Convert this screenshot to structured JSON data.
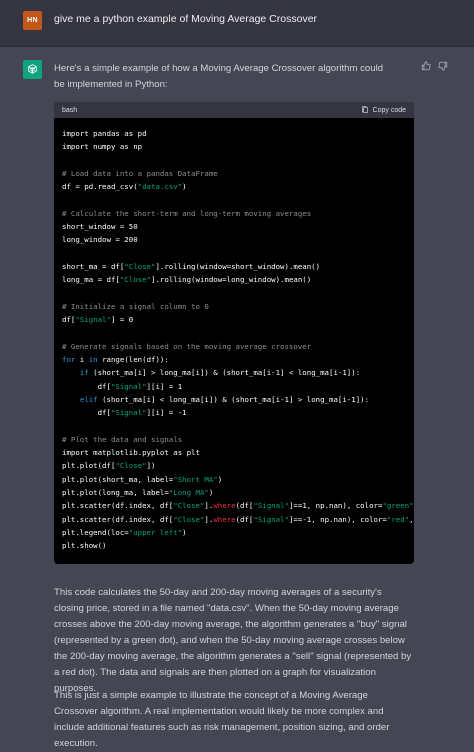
{
  "user": {
    "initials": "HN",
    "message": "give me a python example of Moving Average Crossover"
  },
  "assistant": {
    "intro": "Here's a simple example of how a Moving Average Crossover algorithm could be implemented in Python:",
    "code_language": "bash",
    "copy_label": "Copy code",
    "code_lines": [
      [
        {
          "t": "import pandas as pd",
          "c": ""
        }
      ],
      [
        {
          "t": "import numpy as np",
          "c": ""
        }
      ],
      [],
      [
        {
          "t": "# Load data into a pandas DataFrame",
          "c": "cm"
        }
      ],
      [
        {
          "t": "df = pd.read_csv(",
          "c": ""
        },
        {
          "t": "\"data.csv\"",
          "c": "st"
        },
        {
          "t": ")",
          "c": ""
        }
      ],
      [],
      [
        {
          "t": "# Calculate the short-term and long-term moving averages",
          "c": "cm"
        }
      ],
      [
        {
          "t": "short_window = 50",
          "c": ""
        }
      ],
      [
        {
          "t": "long_window = 200",
          "c": ""
        }
      ],
      [],
      [
        {
          "t": "short_ma = df[",
          "c": ""
        },
        {
          "t": "\"Close\"",
          "c": "st"
        },
        {
          "t": "].rolling(window=short_window).mean()",
          "c": ""
        }
      ],
      [
        {
          "t": "long_ma = df[",
          "c": ""
        },
        {
          "t": "\"Close\"",
          "c": "st"
        },
        {
          "t": "].rolling(window=long_window).mean()",
          "c": ""
        }
      ],
      [],
      [
        {
          "t": "# Initialize a signal column to 0",
          "c": "cm"
        }
      ],
      [
        {
          "t": "df[",
          "c": ""
        },
        {
          "t": "\"Signal\"",
          "c": "st"
        },
        {
          "t": "] = 0",
          "c": ""
        }
      ],
      [],
      [
        {
          "t": "# Generate signals based on the moving average crossover",
          "c": "cm"
        }
      ],
      [
        {
          "t": "for",
          "c": "kw"
        },
        {
          "t": " i ",
          "c": ""
        },
        {
          "t": "in",
          "c": "kw"
        },
        {
          "t": " range(len(df)):",
          "c": ""
        }
      ],
      [
        {
          "t": "    ",
          "c": ""
        },
        {
          "t": "if",
          "c": "kw"
        },
        {
          "t": " (short_ma[i] > long_ma[i]) & (short_ma[i-1] < long_ma[i-1]):",
          "c": ""
        }
      ],
      [
        {
          "t": "        df[",
          "c": ""
        },
        {
          "t": "\"Signal\"",
          "c": "st"
        },
        {
          "t": "][i] = 1",
          "c": ""
        }
      ],
      [
        {
          "t": "    ",
          "c": ""
        },
        {
          "t": "elif",
          "c": "kw"
        },
        {
          "t": " (short_ma[i] < long_ma[i]) & (short_ma[i-1] > long_ma[i-1]):",
          "c": ""
        }
      ],
      [
        {
          "t": "        df[",
          "c": ""
        },
        {
          "t": "\"Signal\"",
          "c": "st"
        },
        {
          "t": "][i] = -1",
          "c": ""
        }
      ],
      [],
      [
        {
          "t": "# Plot the data and signals",
          "c": "cm"
        }
      ],
      [
        {
          "t": "import matplotlib.pyplot as plt",
          "c": ""
        }
      ],
      [
        {
          "t": "plt.plot(df[",
          "c": ""
        },
        {
          "t": "\"Close\"",
          "c": "st"
        },
        {
          "t": "])",
          "c": ""
        }
      ],
      [
        {
          "t": "plt.plot(short_ma, label=",
          "c": ""
        },
        {
          "t": "\"Short MA\"",
          "c": "st"
        },
        {
          "t": ")",
          "c": ""
        }
      ],
      [
        {
          "t": "plt.plot(long_ma, label=",
          "c": ""
        },
        {
          "t": "\"Long MA\"",
          "c": "st"
        },
        {
          "t": ")",
          "c": ""
        }
      ],
      [
        {
          "t": "plt.scatter(df.index, df[",
          "c": ""
        },
        {
          "t": "\"Close\"",
          "c": "st"
        },
        {
          "t": "].",
          "c": ""
        },
        {
          "t": "where",
          "c": "fn"
        },
        {
          "t": "(df[",
          "c": ""
        },
        {
          "t": "\"Signal\"",
          "c": "st"
        },
        {
          "t": "]==1, np.nan), color=",
          "c": ""
        },
        {
          "t": "\"green\"",
          "c": "st"
        },
        {
          "t": ", lab",
          "c": ""
        }
      ],
      [
        {
          "t": "plt.scatter(df.index, df[",
          "c": ""
        },
        {
          "t": "\"Close\"",
          "c": "st"
        },
        {
          "t": "].",
          "c": ""
        },
        {
          "t": "where",
          "c": "fn"
        },
        {
          "t": "(df[",
          "c": ""
        },
        {
          "t": "\"Signal\"",
          "c": "st"
        },
        {
          "t": "]==-1, np.nan), color=",
          "c": ""
        },
        {
          "t": "\"red\"",
          "c": "st"
        },
        {
          "t": ", lab",
          "c": ""
        }
      ],
      [
        {
          "t": "plt.legend(loc=",
          "c": ""
        },
        {
          "t": "\"upper left\"",
          "c": "st"
        },
        {
          "t": ")",
          "c": ""
        }
      ],
      [
        {
          "t": "plt.show()",
          "c": ""
        }
      ]
    ],
    "paragraph1": "This code calculates the 50-day and 200-day moving averages of a security's closing price, stored in a file named \"data.csv\". When the 50-day moving average crosses above the 200-day moving average, the algorithm generates a \"buy\" signal (represented by a green dot), and when the 50-day moving average crosses below the 200-day moving average, the algorithm generates a \"sell\" signal (represented by a red dot). The data and signals are then plotted on a graph for visualization purposes.",
    "paragraph2": "This is just a simple example to illustrate the concept of a Moving Average Crossover algorithm. A real implementation would likely be more complex and include additional features such as risk management, position sizing, and order execution."
  },
  "colors": {
    "user_bg": "#343541",
    "assistant_bg": "#444654",
    "avatar_user": "#c2571a",
    "avatar_assistant": "#10a37f",
    "code_bg": "#000000",
    "string": "#00a67d",
    "keyword": "#2e95d3",
    "comment": "#8e8e8e"
  },
  "icons": {
    "assistant_avatar": "openai-logo-icon",
    "copy": "clipboard-icon",
    "thumbs_up": "thumbs-up-icon",
    "thumbs_down": "thumbs-down-icon"
  }
}
